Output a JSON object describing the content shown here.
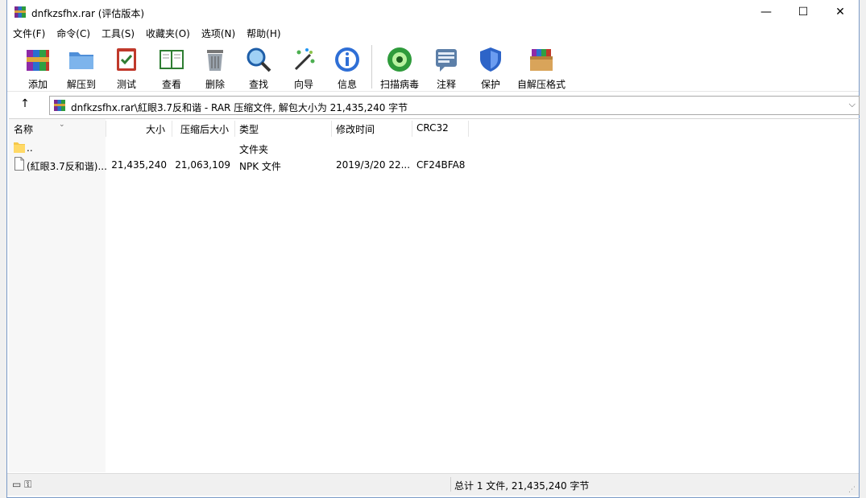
{
  "window": {
    "title": "dnfkzsfhx.rar (评估版本)",
    "controls": {
      "minimize": "—",
      "maximize": "☐",
      "close": "✕"
    }
  },
  "menu": [
    "文件(F)",
    "命令(C)",
    "工具(S)",
    "收藏夹(O)",
    "选项(N)",
    "帮助(H)"
  ],
  "toolbar": {
    "add": "添加",
    "extract": "解压到",
    "test": "测试",
    "view": "查看",
    "delete": "删除",
    "find": "查找",
    "wizard": "向导",
    "info": "信息",
    "scan": "扫描病毒",
    "comment": "注释",
    "protect": "保护",
    "sfx": "自解压格式"
  },
  "address": {
    "up": "↑",
    "path": "dnfkzsfhx.rar\\紅眼3.7反和谐 - RAR 压缩文件, 解包大小为 21,435,240 字节",
    "dropdown": "⌵"
  },
  "columns": {
    "name": "名称",
    "size": "大小",
    "packed": "压缩后大小",
    "type": "类型",
    "modified": "修改时间",
    "crc": "CRC32"
  },
  "rows": [
    {
      "name": "..",
      "size": "",
      "packed": "",
      "type": "文件夹",
      "modified": "",
      "crc": ""
    },
    {
      "name": "(紅眼3.7反和谐)...",
      "size": "21,435,240",
      "packed": "21,063,109",
      "type": "NPK 文件",
      "modified": "2019/3/20 22...",
      "crc": "CF24BFA8"
    }
  ],
  "status": {
    "summary": "总计 1 文件, 21,435,240 字节"
  },
  "colors": {
    "folder": "#f5c84a",
    "accent_border": "#7a9ac7"
  }
}
